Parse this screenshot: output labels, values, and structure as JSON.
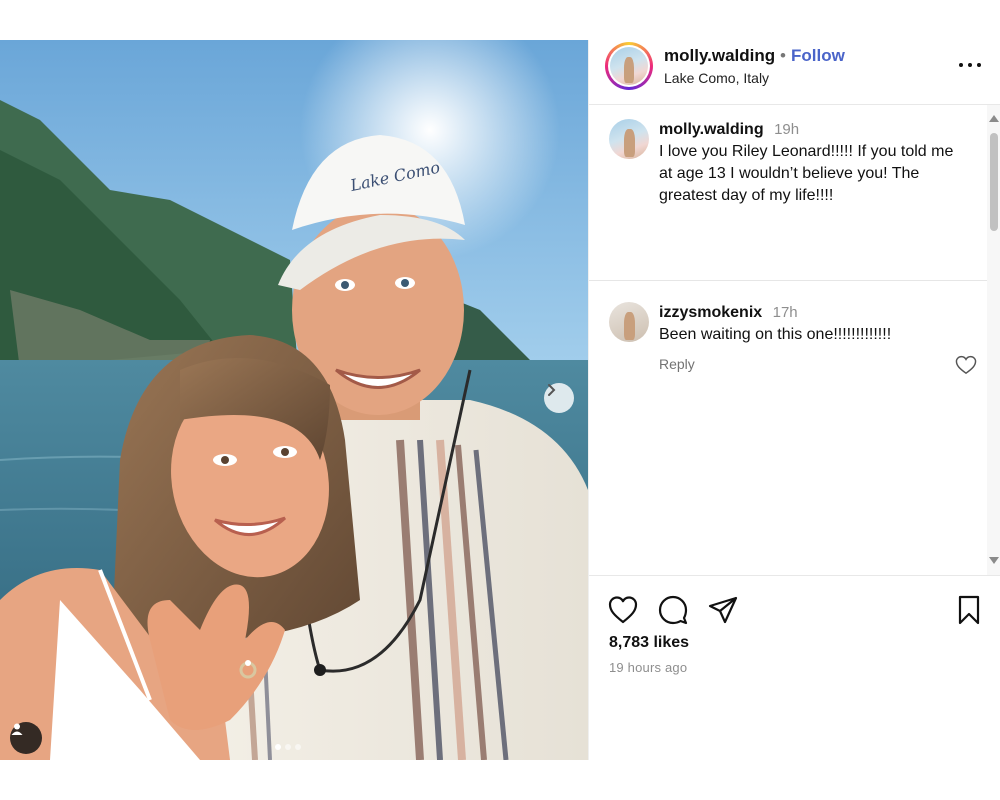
{
  "post": {
    "username": "molly.walding",
    "separator": "•",
    "follow_label": "Follow",
    "location": "Lake Como, Italy",
    "more_icon": "more-horizontal-icon"
  },
  "photo": {
    "cap_text": "Lake Como",
    "carousel_count": 3,
    "carousel_active": 1
  },
  "comments": [
    {
      "username": "molly.walding",
      "time": "19h",
      "text": "I love you Riley Leonard!!!!! If you told me at age 13 I wouldn’t believe you! The greatest day of my life!!!!"
    },
    {
      "username": "izzysmokenix",
      "time": "17h",
      "text": "Been waiting on this one!!!!!!!!!!!!!",
      "reply_label": "Reply"
    }
  ],
  "actions": {
    "icons": [
      "heart-icon",
      "comment-icon",
      "share-icon",
      "bookmark-icon"
    ],
    "likes": "8,783 likes",
    "time_ago": "19 hours ago"
  }
}
